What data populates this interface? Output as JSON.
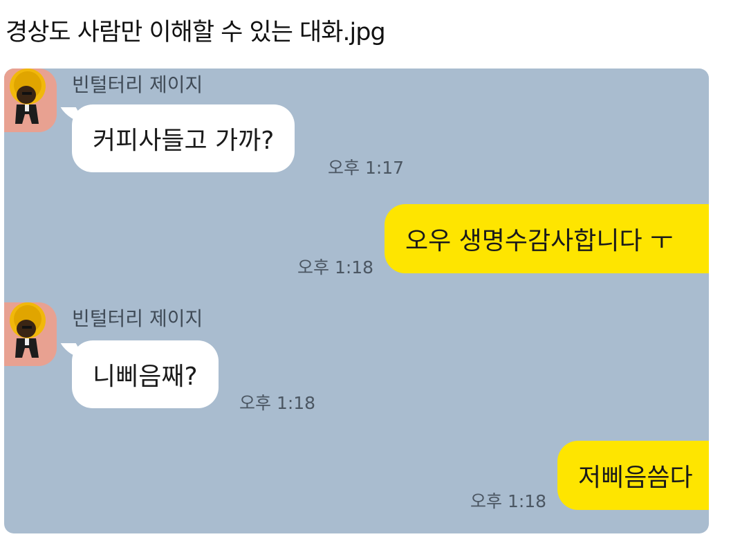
{
  "post": {
    "title": "경상도 사람만 이해할 수 있는 대화.jpg"
  },
  "chat": {
    "messages": [
      {
        "sender": "빈털터리 제이지",
        "text": "커피사들고 가까?",
        "time": "오후 1:17",
        "direction": "incoming"
      },
      {
        "text": "오우 생명수감사합니다 ㅜ",
        "time": "오후 1:18",
        "direction": "outgoing"
      },
      {
        "sender": "빈털터리 제이지",
        "text": "니삐음째?",
        "time": "오후 1:18",
        "direction": "incoming"
      },
      {
        "text": "저삐음씀다",
        "time": "오후 1:18",
        "direction": "outgoing"
      }
    ]
  },
  "colors": {
    "chat_background": "#a9bccf",
    "incoming_bubble": "#ffffff",
    "outgoing_bubble": "#fee500",
    "avatar_background": "#e8a191"
  },
  "icons": {
    "avatar": "afro-character-avatar"
  }
}
